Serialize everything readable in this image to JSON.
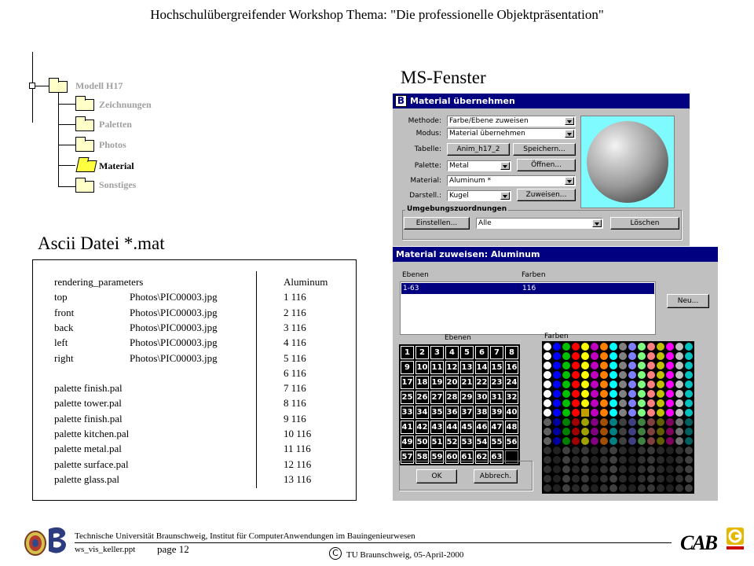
{
  "header": {
    "title": "Hochschulübergreifender Workshop Thema: \"Die professionelle Objektpräsentation\""
  },
  "tree": {
    "root": "Modell H17",
    "children": [
      "Zeichnungen",
      "Paletten",
      "Photos",
      "Material",
      "Sonstiges"
    ],
    "active": "Material"
  },
  "sections": {
    "ms_window": "MS-Fenster",
    "ascii": "Ascii Datei *.mat"
  },
  "ascii_file": {
    "rows": [
      {
        "c1": "rendering_parameters",
        "c2": "",
        "c3": "Aluminum"
      },
      {
        "c1": "top",
        "c2": "Photos\\PIC00003.jpg",
        "c3": "1 116"
      },
      {
        "c1": "front",
        "c2": "Photos\\PIC00003.jpg",
        "c3": "2 116"
      },
      {
        "c1": "back",
        "c2": "Photos\\PIC00003.jpg",
        "c3": "3 116"
      },
      {
        "c1": "left",
        "c2": "Photos\\PIC00003.jpg",
        "c3": "4 116"
      },
      {
        "c1": "right",
        "c2": "Photos\\PIC00003.jpg",
        "c3": "5 116"
      },
      {
        "c1": "",
        "c2": "",
        "c3": "6 116"
      },
      {
        "c1": "palette finish.pal",
        "c2": "",
        "c3": "7 116"
      },
      {
        "c1": "palette tower.pal",
        "c2": "",
        "c3": "8 116"
      },
      {
        "c1": "palette finish.pal",
        "c2": "",
        "c3": "9 116"
      },
      {
        "c1": "palette kitchen.pal",
        "c2": "",
        "c3": "10 116"
      },
      {
        "c1": "palette metal.pal",
        "c2": "",
        "c3": "11 116"
      },
      {
        "c1": "palette surface.pal",
        "c2": "",
        "c3": "12 116"
      },
      {
        "c1": "palette glass.pal",
        "c2": "",
        "c3": "13 116"
      }
    ]
  },
  "dialog1": {
    "title": "Material übernehmen",
    "fields": [
      {
        "label": "Methode:",
        "value": "Farbe/Ebene zuweisen"
      },
      {
        "label": "Modus:",
        "value": "Material übernehmen"
      },
      {
        "label": "Tabelle:",
        "value": "Anim_h17_2"
      },
      {
        "label": "Palette:",
        "value": "Metal"
      },
      {
        "label": "Material:",
        "value": "Aluminum *"
      },
      {
        "label": "Darstell.:",
        "value": "Kugel"
      }
    ],
    "buttons": {
      "save": "Speichern...",
      "open": "Öffnen...",
      "assign": "Zuweisen..."
    },
    "group": {
      "title": "Umgebungszuordnungen",
      "settings": "Einstellen...",
      "filter": "Alle",
      "delete": "Löschen"
    }
  },
  "dialog2": {
    "title": "Material zuweisen: Aluminum",
    "columns": {
      "layers": "Ebenen",
      "colors": "Farben"
    },
    "list_row": {
      "layers": "1-63",
      "colors": "116"
    },
    "new_button": "Neu...",
    "grid_labels": {
      "layers": "Ebenen",
      "colors": "Farben"
    },
    "layer_numbers": [
      "1",
      "2",
      "3",
      "4",
      "5",
      "6",
      "7",
      "8",
      "9",
      "10",
      "11",
      "12",
      "13",
      "14",
      "15",
      "16",
      "17",
      "18",
      "19",
      "20",
      "21",
      "22",
      "23",
      "24",
      "25",
      "26",
      "27",
      "28",
      "29",
      "30",
      "31",
      "32",
      "33",
      "34",
      "35",
      "36",
      "37",
      "38",
      "39",
      "40",
      "41",
      "42",
      "43",
      "44",
      "45",
      "46",
      "47",
      "48",
      "49",
      "50",
      "51",
      "52",
      "53",
      "54",
      "55",
      "56",
      "57",
      "58",
      "59",
      "60",
      "61",
      "62",
      "63"
    ],
    "ok": "OK",
    "cancel": "Abbrech."
  },
  "footer": {
    "institution": "Technische Universität Braunschweig, Institut für ComputerAnwendungen im Bauingenieurwesen",
    "file": "ws_vis_keller.ppt",
    "page": "page 12",
    "copyright_symbol": "C",
    "date": "TU Braunschweig, 05-April-2000",
    "logo_right": "CAB"
  },
  "colors": {
    "titlebar": "#000080",
    "dialog_bg": "#c0c0c0",
    "sphere_bg": "#7ffbff",
    "folder": "#ffffc8",
    "folder_active": "#ffff40",
    "tree_inactive_text": "#a0a0a0"
  }
}
